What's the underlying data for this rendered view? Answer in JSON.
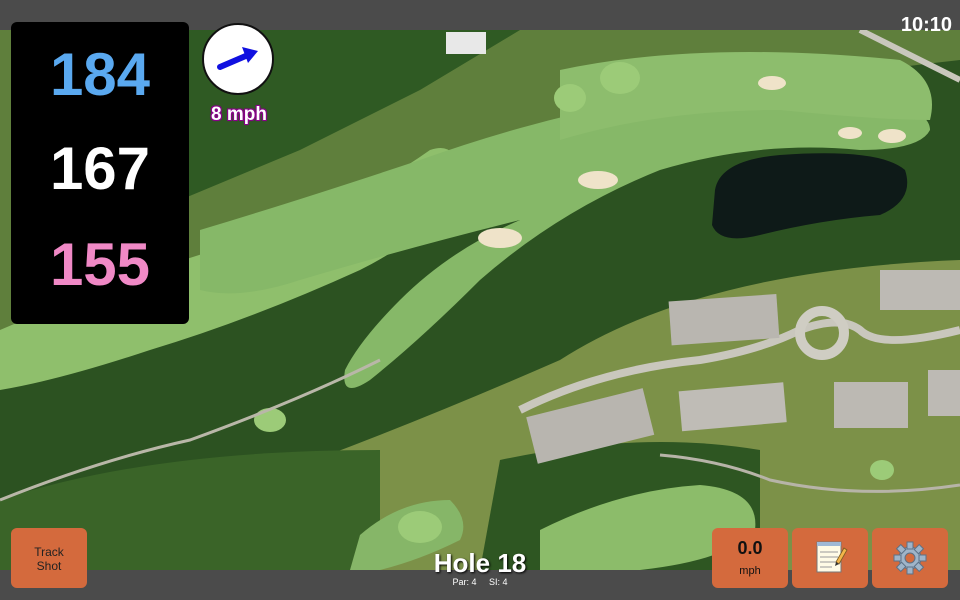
{
  "status": {
    "time": "10:10"
  },
  "distances": {
    "back": "184",
    "middle": "167",
    "front": "155"
  },
  "wind": {
    "speed_label": "8 mph",
    "icon": "wind-arrow-icon"
  },
  "buttons": {
    "track_shot_line1": "Track",
    "track_shot_line2": "Shot",
    "speed_value": "0.0",
    "speed_unit": "mph",
    "notes_icon": "notepad-icon",
    "settings_icon": "gear-icon"
  },
  "hole": {
    "title": "Hole 18",
    "par": "Par: 4",
    "si": "SI: 4"
  },
  "colors": {
    "back": "#5aa9f0",
    "middle": "#ffffff",
    "front": "#f089c6",
    "button": "#d46a3d",
    "bar": "#4b4b4b",
    "wind_arrow": "#1010e0"
  }
}
